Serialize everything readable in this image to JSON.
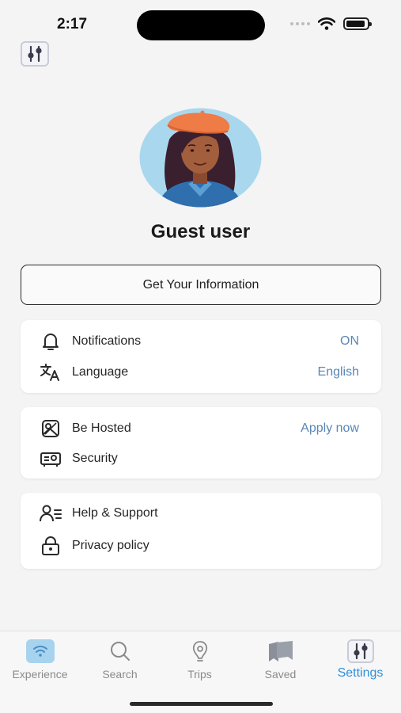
{
  "status_bar": {
    "time": "2:17"
  },
  "profile": {
    "name": "Guest user"
  },
  "info_button": {
    "label": "Get Your Information"
  },
  "settings": {
    "group1": [
      {
        "label": "Notifications",
        "value": "ON",
        "icon": "bell-icon"
      },
      {
        "label": "Language",
        "value": "English",
        "icon": "translate-icon"
      }
    ],
    "group2": [
      {
        "label": "Be Hosted",
        "value": "Apply now",
        "icon": "hosted-icon"
      },
      {
        "label": "Security",
        "icon": "security-icon"
      }
    ],
    "group3": [
      {
        "label": "Help & Support",
        "icon": "support-icon"
      },
      {
        "label": "Privacy policy",
        "icon": "lock-icon"
      }
    ]
  },
  "tabs": [
    {
      "label": "Experience",
      "icon": "wifi-icon"
    },
    {
      "label": "Search",
      "icon": "search-icon"
    },
    {
      "label": "Trips",
      "icon": "location-pin-icon"
    },
    {
      "label": "Saved",
      "icon": "bookmark-icon"
    },
    {
      "label": "Settings",
      "icon": "sliders-icon",
      "active": true
    }
  ],
  "colors": {
    "accent": "#2f8fd8",
    "value_text": "#5a86b8",
    "background": "#f4f4f4"
  }
}
